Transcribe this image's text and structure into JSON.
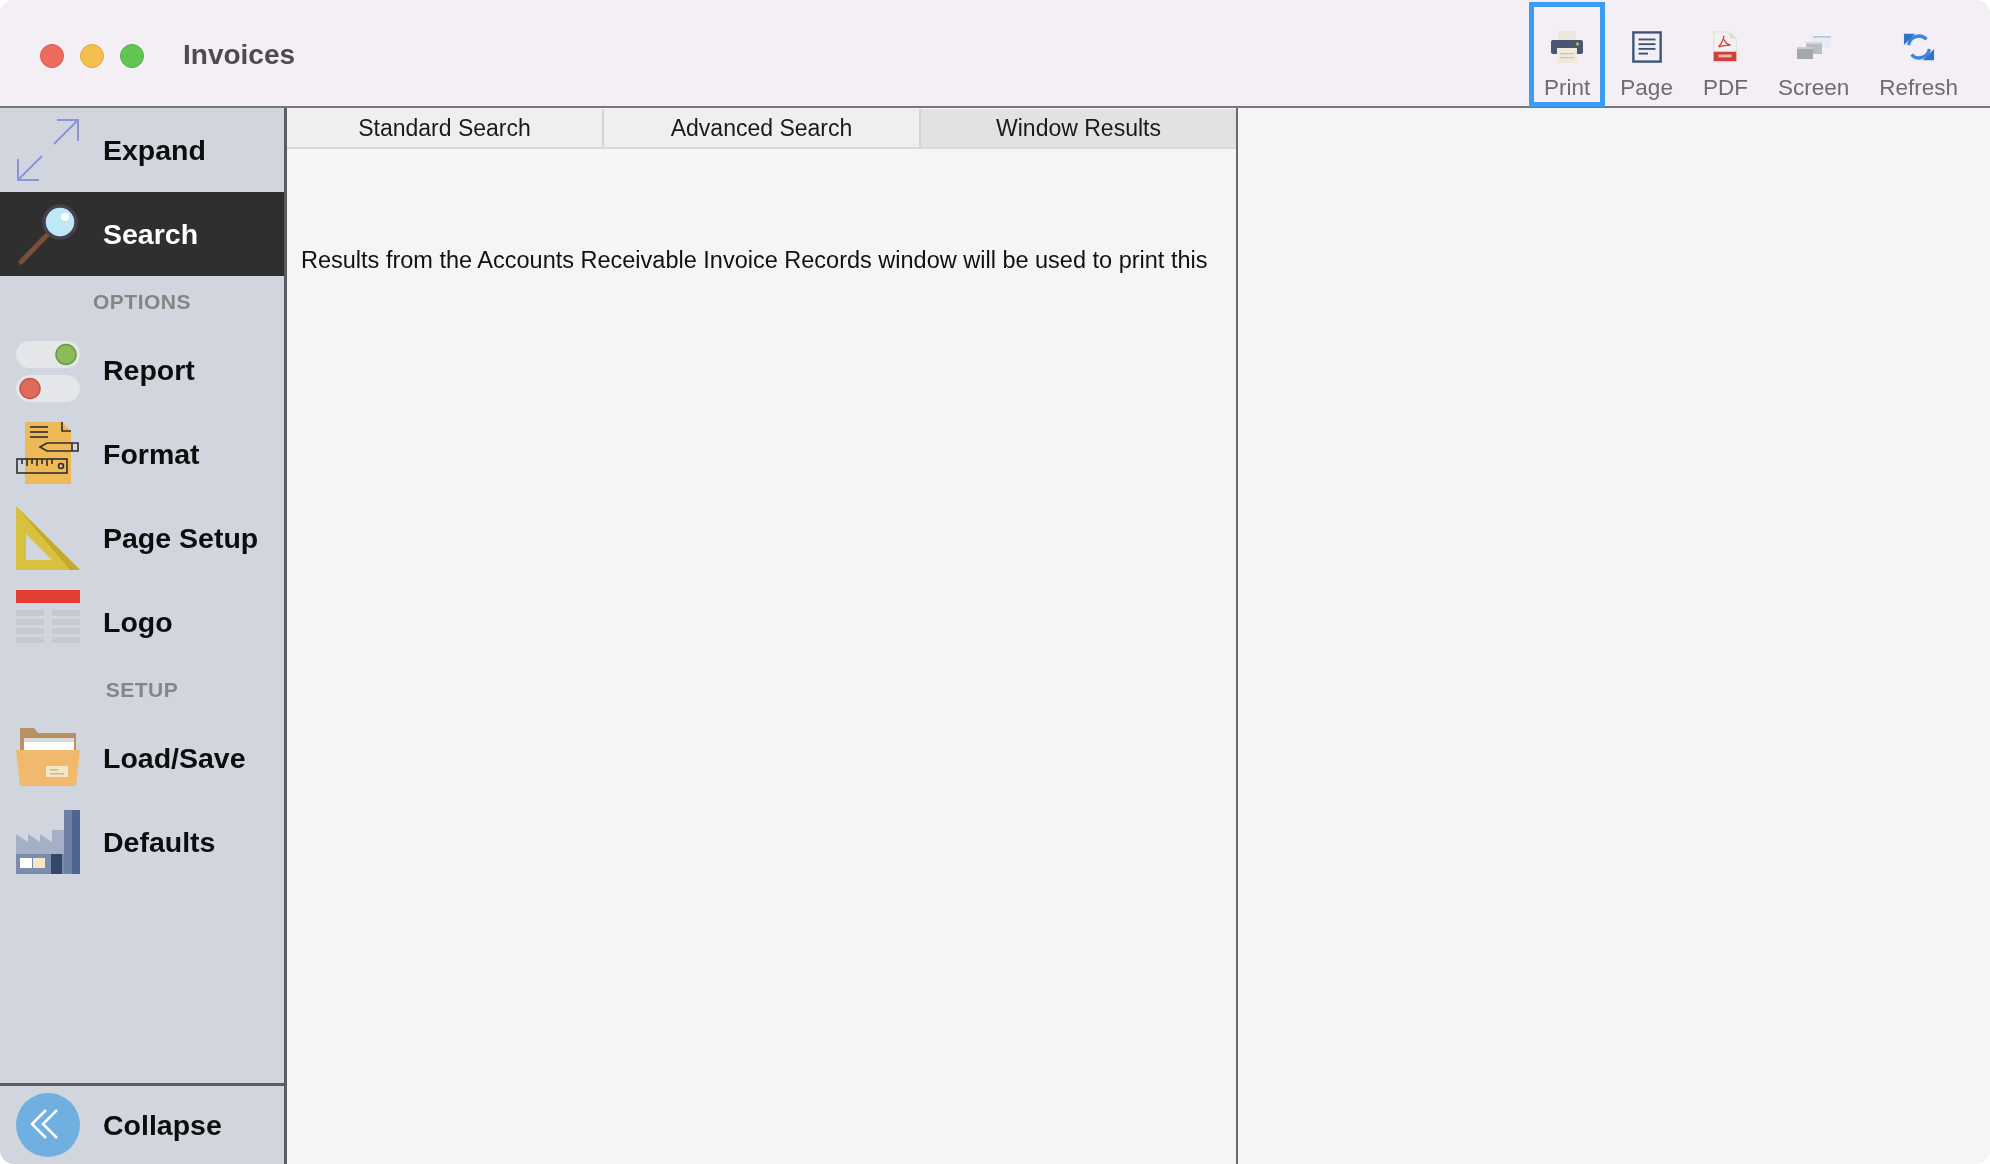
{
  "window": {
    "title": "Invoices"
  },
  "toolbar": {
    "buttons": [
      {
        "label": "Print",
        "selected": true
      },
      {
        "label": "Page",
        "selected": false
      },
      {
        "label": "PDF",
        "selected": false
      },
      {
        "label": "Screen",
        "selected": false
      },
      {
        "label": "Refresh",
        "selected": false
      }
    ]
  },
  "sidebar": {
    "items": [
      {
        "label": "Expand",
        "selected": false
      },
      {
        "label": "Search",
        "selected": true
      }
    ],
    "sections": [
      {
        "heading": "OPTIONS",
        "items": [
          {
            "label": "Report",
            "selected": false
          },
          {
            "label": "Format",
            "selected": false
          },
          {
            "label": "Page Setup",
            "selected": false
          },
          {
            "label": "Logo",
            "selected": false
          }
        ]
      },
      {
        "heading": "SETUP",
        "items": [
          {
            "label": "Load/Save",
            "selected": false
          },
          {
            "label": "Defaults",
            "selected": false
          }
        ]
      }
    ],
    "footer": {
      "label": "Collapse"
    }
  },
  "tabs": [
    {
      "label": "Standard Search",
      "selected": false
    },
    {
      "label": "Advanced Search",
      "selected": false
    },
    {
      "label": "Window Results",
      "selected": true
    }
  ],
  "message": "Results from the Accounts Receivable Invoice Records window will be used to print this"
}
